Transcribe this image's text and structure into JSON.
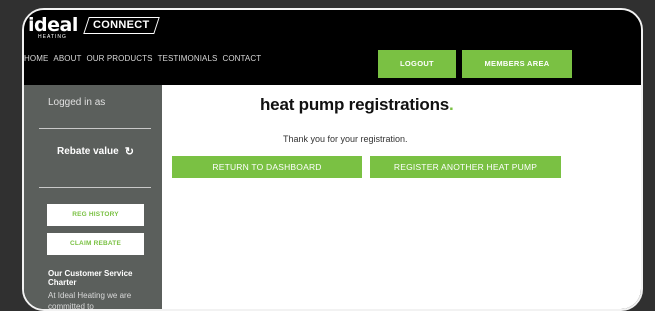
{
  "header": {
    "logo_main": "ideal",
    "logo_sub": "HEATING",
    "logo_connect": "CONNECT",
    "nav": [
      "HOME",
      "ABOUT",
      "OUR PRODUCTS",
      "TESTIMONIALS",
      "CONTACT"
    ],
    "logout_label": "LOGOUT",
    "members_label": "MEMBERS AREA"
  },
  "sidebar": {
    "logged_in": "Logged in as",
    "rebate_label": "Rebate value",
    "reg_history_label": "REG HISTORY",
    "claim_rebate_label": "CLAIM REBATE",
    "charter_title": "Our Customer Service Charter",
    "charter_text": "At Ideal Heating we are committed to"
  },
  "main": {
    "title": "heat pump registrations",
    "title_dot": ".",
    "thanks": "Thank you for your registration.",
    "return_label": "RETURN TO DASHBOARD",
    "register_label": "REGISTER ANOTHER HEAT PUMP"
  },
  "colors": {
    "accent": "#7ac143",
    "sidebar": "#5b5f5c",
    "header": "#000000"
  },
  "icons": {
    "rebate_refresh": "refresh-icon"
  }
}
